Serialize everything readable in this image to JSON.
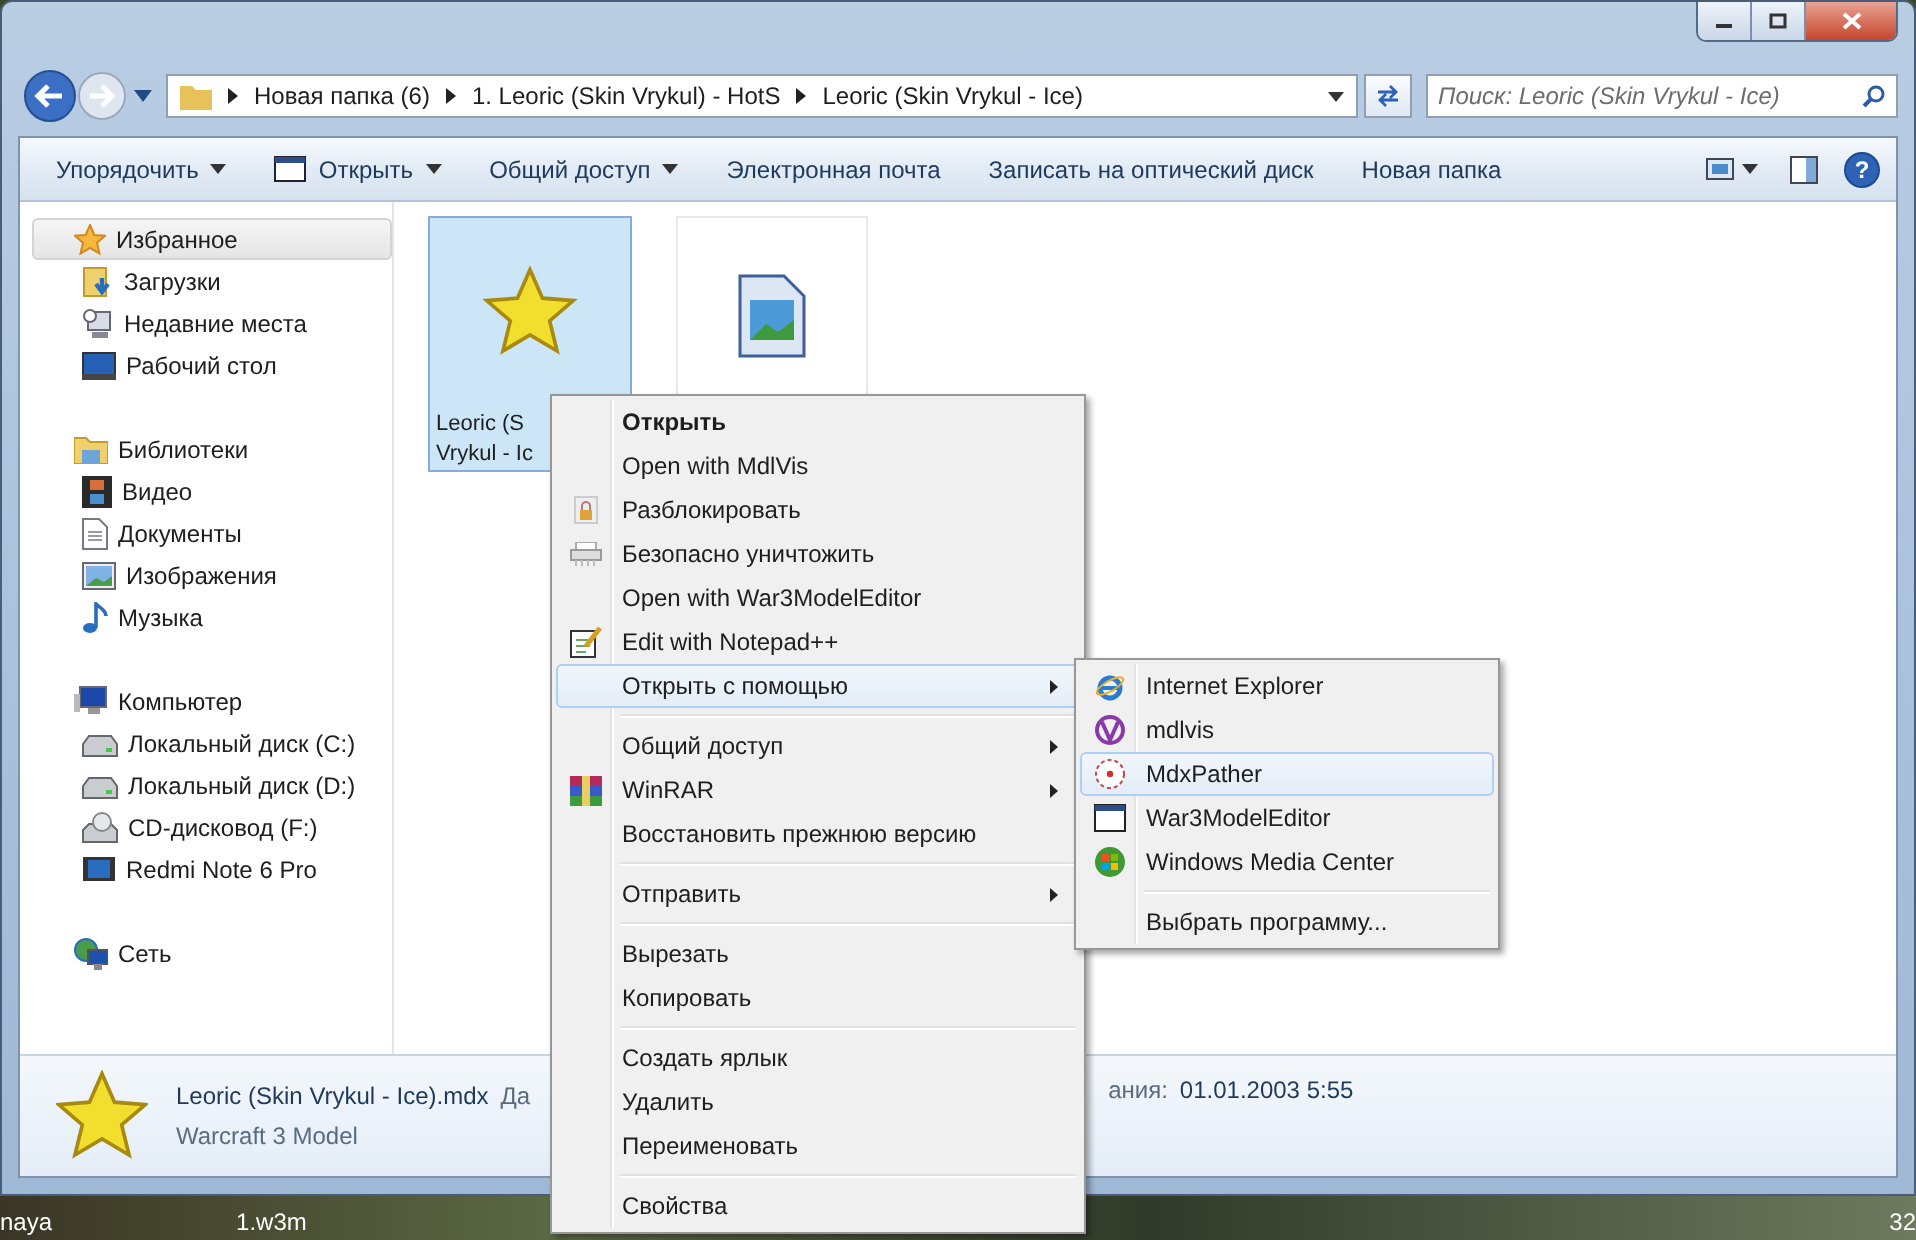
{
  "address": {
    "crumbs": [
      "Новая папка (6)",
      "1. Leoric (Skin Vrykul) - HotS",
      "Leoric (Skin Vrykul - Ice)"
    ]
  },
  "search": {
    "placeholder": "Поиск: Leoric (Skin Vrykul - Ice)"
  },
  "toolbar": [
    {
      "label": "Упорядочить",
      "dropdown": true
    },
    {
      "label": "Открыть",
      "dropdown": true
    },
    {
      "label": "Общий доступ",
      "dropdown": true
    },
    {
      "label": "Электронная почта",
      "dropdown": false
    },
    {
      "label": "Записать на оптический диск",
      "dropdown": false
    },
    {
      "label": "Новая папка",
      "dropdown": false
    }
  ],
  "help_button": {
    "label": "?"
  },
  "sidebar": {
    "groups": [
      {
        "label": "Избранное",
        "selected": true,
        "children": [
          {
            "label": "Загрузки"
          },
          {
            "label": "Недавние места"
          },
          {
            "label": "Рабочий стол"
          }
        ]
      },
      {
        "label": "Библиотеки",
        "selected": false,
        "children": [
          {
            "label": "Видео"
          },
          {
            "label": "Документы"
          },
          {
            "label": "Изображения"
          },
          {
            "label": "Музыка"
          }
        ]
      },
      {
        "label": "Компьютер",
        "selected": false,
        "children": [
          {
            "label": "Локальный диск (C:)"
          },
          {
            "label": "Локальный диск (D:)"
          },
          {
            "label": "CD-дисковод (F:)"
          },
          {
            "label": "Redmi Note 6 Pro"
          }
        ]
      },
      {
        "label": "Сеть",
        "selected": false
      }
    ]
  },
  "files": [
    {
      "selected": true,
      "label_lines": [
        "Leoric (S",
        "Vrykul - Ic"
      ]
    },
    {
      "selected": false
    }
  ],
  "context_menu": [
    {
      "kind": "item",
      "label": "Открыть",
      "default": true,
      "submenu": false,
      "selected": false
    },
    {
      "kind": "item",
      "label": "Open with MdlVis",
      "default": false,
      "submenu": false,
      "selected": false
    },
    {
      "kind": "item",
      "label": "Разблокировать",
      "default": false,
      "submenu": false,
      "selected": false
    },
    {
      "kind": "item",
      "label": "Безопасно уничтожить",
      "default": false,
      "submenu": false,
      "selected": false
    },
    {
      "kind": "item",
      "label": "Open with War3ModelEditor",
      "default": false,
      "submenu": false,
      "selected": false
    },
    {
      "kind": "item",
      "label": "Edit with Notepad++",
      "default": false,
      "submenu": false,
      "selected": false
    },
    {
      "kind": "item",
      "label": "Открыть с помощью",
      "default": false,
      "submenu": true,
      "selected": true
    },
    {
      "kind": "separator"
    },
    {
      "kind": "item",
      "label": "Общий доступ",
      "default": false,
      "submenu": true,
      "selected": false
    },
    {
      "kind": "item",
      "label": "WinRAR",
      "default": false,
      "submenu": true,
      "selected": false
    },
    {
      "kind": "item",
      "label": "Восстановить прежнюю версию",
      "default": false,
      "submenu": false,
      "selected": false
    },
    {
      "kind": "separator"
    },
    {
      "kind": "item",
      "label": "Отправить",
      "default": false,
      "submenu": true,
      "selected": false
    },
    {
      "kind": "separator"
    },
    {
      "kind": "item",
      "label": "Вырезать",
      "default": false,
      "submenu": false,
      "selected": false
    },
    {
      "kind": "item",
      "label": "Копировать",
      "default": false,
      "submenu": false,
      "selected": false
    },
    {
      "kind": "separator"
    },
    {
      "kind": "item",
      "label": "Создать ярлык",
      "default": false,
      "submenu": false,
      "selected": false
    },
    {
      "kind": "item",
      "label": "Удалить",
      "default": false,
      "submenu": false,
      "selected": false
    },
    {
      "kind": "item",
      "label": "Переименовать",
      "default": false,
      "submenu": false,
      "selected": false
    },
    {
      "kind": "separator"
    },
    {
      "kind": "item",
      "label": "Свойства",
      "default": false,
      "submenu": false,
      "selected": false
    }
  ],
  "open_with_menu": [
    {
      "kind": "item",
      "label": "Internet Explorer",
      "selected": false
    },
    {
      "kind": "item",
      "label": "mdlvis",
      "selected": false
    },
    {
      "kind": "item",
      "label": "MdxPather",
      "selected": true
    },
    {
      "kind": "item",
      "label": "War3ModelEditor",
      "selected": false
    },
    {
      "kind": "item",
      "label": "Windows Media Center",
      "selected": false
    },
    {
      "kind": "separator"
    },
    {
      "kind": "item",
      "label": "Выбрать программу...",
      "selected": false
    }
  ],
  "details": {
    "name": "Leoric (Skin Vrykul - Ice).mdx",
    "type": "Warcraft 3 Model",
    "field_label_start": "Да",
    "field_label_end": "ания:",
    "field_value": "01.01.2003 5:55"
  },
  "desktop": {
    "labels": [
      "naya",
      "1.w3m",
      "32"
    ]
  }
}
